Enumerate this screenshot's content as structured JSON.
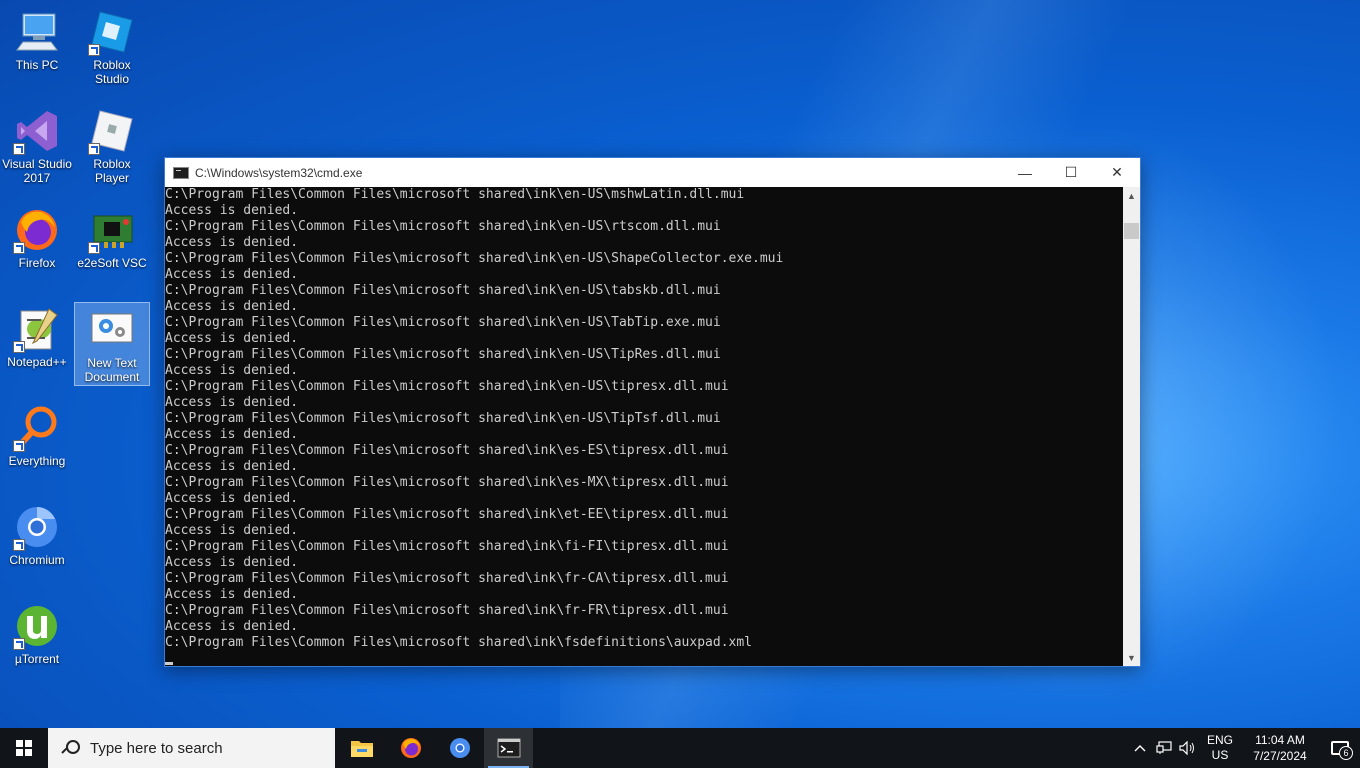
{
  "desktop": {
    "icons": [
      {
        "label": "This PC"
      },
      {
        "label": "Roblox Studio"
      },
      {
        "label": "Visual Studio 2017"
      },
      {
        "label": "Roblox Player"
      },
      {
        "label": "Firefox"
      },
      {
        "label": "e2eSoft VSC"
      },
      {
        "label": "Notepad++"
      },
      {
        "label": "New Text Document"
      },
      {
        "label": "Everything"
      },
      {
        "label": "Chromium"
      },
      {
        "label": "µTorrent"
      }
    ]
  },
  "cmd_window": {
    "title": "C:\\Windows\\system32\\cmd.exe",
    "minimize": "—",
    "maximize": "☐",
    "close": "✕",
    "lines": [
      "C:\\Program Files\\Common Files\\microsoft shared\\ink\\en-US\\mshwLatin.dll.mui",
      "Access is denied.",
      "C:\\Program Files\\Common Files\\microsoft shared\\ink\\en-US\\rtscom.dll.mui",
      "Access is denied.",
      "C:\\Program Files\\Common Files\\microsoft shared\\ink\\en-US\\ShapeCollector.exe.mui",
      "Access is denied.",
      "C:\\Program Files\\Common Files\\microsoft shared\\ink\\en-US\\tabskb.dll.mui",
      "Access is denied.",
      "C:\\Program Files\\Common Files\\microsoft shared\\ink\\en-US\\TabTip.exe.mui",
      "Access is denied.",
      "C:\\Program Files\\Common Files\\microsoft shared\\ink\\en-US\\TipRes.dll.mui",
      "Access is denied.",
      "C:\\Program Files\\Common Files\\microsoft shared\\ink\\en-US\\tipresx.dll.mui",
      "Access is denied.",
      "C:\\Program Files\\Common Files\\microsoft shared\\ink\\en-US\\TipTsf.dll.mui",
      "Access is denied.",
      "C:\\Program Files\\Common Files\\microsoft shared\\ink\\es-ES\\tipresx.dll.mui",
      "Access is denied.",
      "C:\\Program Files\\Common Files\\microsoft shared\\ink\\es-MX\\tipresx.dll.mui",
      "Access is denied.",
      "C:\\Program Files\\Common Files\\microsoft shared\\ink\\et-EE\\tipresx.dll.mui",
      "Access is denied.",
      "C:\\Program Files\\Common Files\\microsoft shared\\ink\\fi-FI\\tipresx.dll.mui",
      "Access is denied.",
      "C:\\Program Files\\Common Files\\microsoft shared\\ink\\fr-CA\\tipresx.dll.mui",
      "Access is denied.",
      "C:\\Program Files\\Common Files\\microsoft shared\\ink\\fr-FR\\tipresx.dll.mui",
      "Access is denied.",
      "C:\\Program Files\\Common Files\\microsoft shared\\ink\\fsdefinitions\\auxpad.xml"
    ]
  },
  "taskbar": {
    "search_placeholder": "Type here to search",
    "apps": [
      {
        "name": "file-explorer-icon"
      },
      {
        "name": "firefox-icon"
      },
      {
        "name": "chromium-icon"
      },
      {
        "name": "cmd-icon"
      }
    ],
    "tray": {
      "lang_top": "ENG",
      "lang_bottom": "US",
      "time": "11:04 AM",
      "date": "7/27/2024",
      "notification_count": "6"
    }
  },
  "colors": {
    "console_bg": "#0c0c0c",
    "console_text": "#cccccc",
    "taskbar_bg": "#111418",
    "desktop_accent": "#0a5fd0"
  }
}
